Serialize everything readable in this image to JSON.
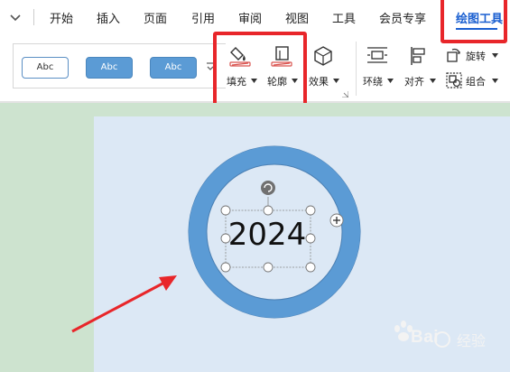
{
  "menubar": {
    "items": [
      "开始",
      "插入",
      "页面",
      "引用",
      "审阅",
      "视图",
      "工具",
      "会员专享",
      "绘图工具"
    ],
    "active_index": 8
  },
  "ribbon": {
    "style_swatches": [
      "Abc",
      "Abc",
      "Abc"
    ],
    "fill_label": "填充",
    "outline_label": "轮廓",
    "effect_label": "效果",
    "wrap_label": "环绕",
    "align_label": "对齐",
    "rotate_label": "旋转",
    "group_label": "组合"
  },
  "canvas": {
    "text_box": "2024"
  },
  "colors": {
    "accent": "#1a5fd0",
    "ring_fill": "#5b9bd5",
    "ring_stroke": "#4a7fb3",
    "highlight": "#e8262a",
    "canvas_bg": "#dce8f5",
    "workspace_bg": "#cde3cf"
  },
  "watermark": {
    "text": "Bai",
    "suffix": "经验"
  }
}
